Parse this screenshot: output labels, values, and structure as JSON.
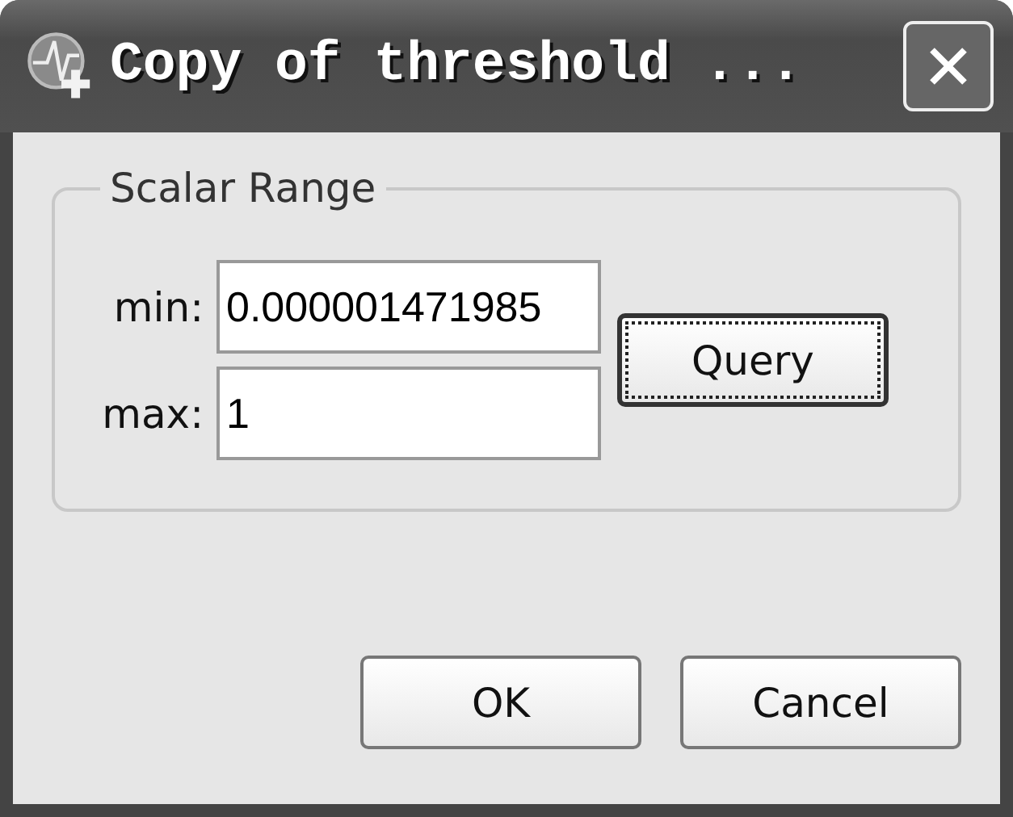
{
  "window": {
    "title": "Copy of threshold ..."
  },
  "group": {
    "title": "Scalar Range",
    "fields": [
      {
        "label": "min:",
        "value": "0.000001471985"
      },
      {
        "label": "max:",
        "value": "1"
      }
    ],
    "query_button": {
      "label": "Query",
      "focused": true
    }
  },
  "buttons": [
    {
      "label": "OK"
    },
    {
      "label": "Cancel"
    }
  ]
}
